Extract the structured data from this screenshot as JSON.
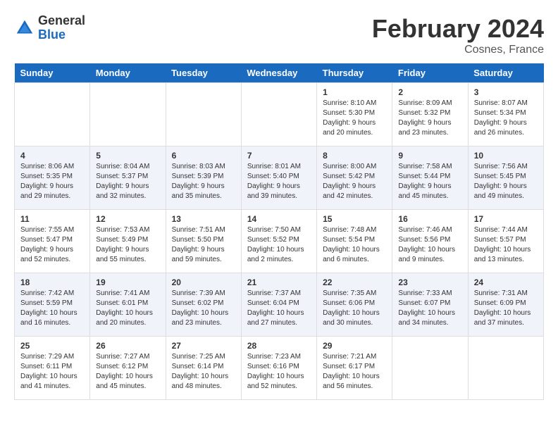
{
  "header": {
    "logo_general": "General",
    "logo_blue": "Blue",
    "title": "February 2024",
    "location": "Cosnes, France"
  },
  "days_of_week": [
    "Sunday",
    "Monday",
    "Tuesday",
    "Wednesday",
    "Thursday",
    "Friday",
    "Saturday"
  ],
  "weeks": [
    [
      {
        "day": "",
        "info": ""
      },
      {
        "day": "",
        "info": ""
      },
      {
        "day": "",
        "info": ""
      },
      {
        "day": "",
        "info": ""
      },
      {
        "day": "1",
        "info": "Sunrise: 8:10 AM\nSunset: 5:30 PM\nDaylight: 9 hours\nand 20 minutes."
      },
      {
        "day": "2",
        "info": "Sunrise: 8:09 AM\nSunset: 5:32 PM\nDaylight: 9 hours\nand 23 minutes."
      },
      {
        "day": "3",
        "info": "Sunrise: 8:07 AM\nSunset: 5:34 PM\nDaylight: 9 hours\nand 26 minutes."
      }
    ],
    [
      {
        "day": "4",
        "info": "Sunrise: 8:06 AM\nSunset: 5:35 PM\nDaylight: 9 hours\nand 29 minutes."
      },
      {
        "day": "5",
        "info": "Sunrise: 8:04 AM\nSunset: 5:37 PM\nDaylight: 9 hours\nand 32 minutes."
      },
      {
        "day": "6",
        "info": "Sunrise: 8:03 AM\nSunset: 5:39 PM\nDaylight: 9 hours\nand 35 minutes."
      },
      {
        "day": "7",
        "info": "Sunrise: 8:01 AM\nSunset: 5:40 PM\nDaylight: 9 hours\nand 39 minutes."
      },
      {
        "day": "8",
        "info": "Sunrise: 8:00 AM\nSunset: 5:42 PM\nDaylight: 9 hours\nand 42 minutes."
      },
      {
        "day": "9",
        "info": "Sunrise: 7:58 AM\nSunset: 5:44 PM\nDaylight: 9 hours\nand 45 minutes."
      },
      {
        "day": "10",
        "info": "Sunrise: 7:56 AM\nSunset: 5:45 PM\nDaylight: 9 hours\nand 49 minutes."
      }
    ],
    [
      {
        "day": "11",
        "info": "Sunrise: 7:55 AM\nSunset: 5:47 PM\nDaylight: 9 hours\nand 52 minutes."
      },
      {
        "day": "12",
        "info": "Sunrise: 7:53 AM\nSunset: 5:49 PM\nDaylight: 9 hours\nand 55 minutes."
      },
      {
        "day": "13",
        "info": "Sunrise: 7:51 AM\nSunset: 5:50 PM\nDaylight: 9 hours\nand 59 minutes."
      },
      {
        "day": "14",
        "info": "Sunrise: 7:50 AM\nSunset: 5:52 PM\nDaylight: 10 hours\nand 2 minutes."
      },
      {
        "day": "15",
        "info": "Sunrise: 7:48 AM\nSunset: 5:54 PM\nDaylight: 10 hours\nand 6 minutes."
      },
      {
        "day": "16",
        "info": "Sunrise: 7:46 AM\nSunset: 5:56 PM\nDaylight: 10 hours\nand 9 minutes."
      },
      {
        "day": "17",
        "info": "Sunrise: 7:44 AM\nSunset: 5:57 PM\nDaylight: 10 hours\nand 13 minutes."
      }
    ],
    [
      {
        "day": "18",
        "info": "Sunrise: 7:42 AM\nSunset: 5:59 PM\nDaylight: 10 hours\nand 16 minutes."
      },
      {
        "day": "19",
        "info": "Sunrise: 7:41 AM\nSunset: 6:01 PM\nDaylight: 10 hours\nand 20 minutes."
      },
      {
        "day": "20",
        "info": "Sunrise: 7:39 AM\nSunset: 6:02 PM\nDaylight: 10 hours\nand 23 minutes."
      },
      {
        "day": "21",
        "info": "Sunrise: 7:37 AM\nSunset: 6:04 PM\nDaylight: 10 hours\nand 27 minutes."
      },
      {
        "day": "22",
        "info": "Sunrise: 7:35 AM\nSunset: 6:06 PM\nDaylight: 10 hours\nand 30 minutes."
      },
      {
        "day": "23",
        "info": "Sunrise: 7:33 AM\nSunset: 6:07 PM\nDaylight: 10 hours\nand 34 minutes."
      },
      {
        "day": "24",
        "info": "Sunrise: 7:31 AM\nSunset: 6:09 PM\nDaylight: 10 hours\nand 37 minutes."
      }
    ],
    [
      {
        "day": "25",
        "info": "Sunrise: 7:29 AM\nSunset: 6:11 PM\nDaylight: 10 hours\nand 41 minutes."
      },
      {
        "day": "26",
        "info": "Sunrise: 7:27 AM\nSunset: 6:12 PM\nDaylight: 10 hours\nand 45 minutes."
      },
      {
        "day": "27",
        "info": "Sunrise: 7:25 AM\nSunset: 6:14 PM\nDaylight: 10 hours\nand 48 minutes."
      },
      {
        "day": "28",
        "info": "Sunrise: 7:23 AM\nSunset: 6:16 PM\nDaylight: 10 hours\nand 52 minutes."
      },
      {
        "day": "29",
        "info": "Sunrise: 7:21 AM\nSunset: 6:17 PM\nDaylight: 10 hours\nand 56 minutes."
      },
      {
        "day": "",
        "info": ""
      },
      {
        "day": "",
        "info": ""
      }
    ]
  ]
}
